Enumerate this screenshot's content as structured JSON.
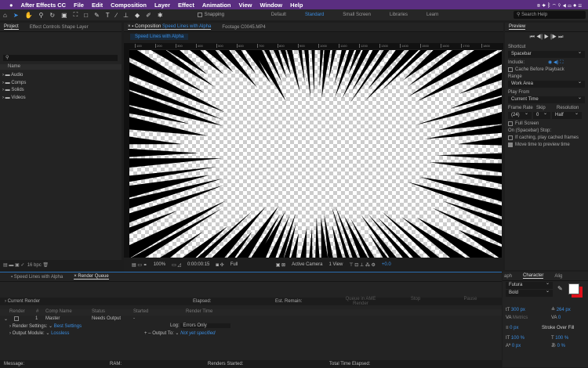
{
  "menubar": {
    "apple": "",
    "app": "After Effects CC",
    "items": [
      "File",
      "Edit",
      "Composition",
      "Layer",
      "Effect",
      "Animation",
      "View",
      "Window",
      "Help"
    ]
  },
  "toolbar": {
    "snapping": "Snapping",
    "workspaces": [
      "Default",
      "Standard",
      "Small Screen",
      "Libraries",
      "Learn"
    ],
    "active_workspace": "Standard",
    "search_placeholder": "Search Help"
  },
  "project": {
    "tabs": [
      "Project",
      "Effect Controls Shape Layer"
    ],
    "column": "Name",
    "folders": [
      "Audio",
      "Comps",
      "Solids",
      "Videos"
    ],
    "bpc": "16 bpc"
  },
  "comp": {
    "tab_prefix": "Composition",
    "tab_name": "Speed Lines with Alpha",
    "footage_tab": "Footage C0045.MP4",
    "breadcrumb": "Speed Lines with Alpha",
    "ruler": [
      "100",
      "200",
      "300",
      "400",
      "500",
      "600",
      "700",
      "800",
      "900",
      "1000",
      "1100",
      "1200",
      "1300",
      "1400",
      "1500",
      "1600",
      "1700",
      "1800"
    ],
    "zoom": "100%",
    "timecode": "0:00:00:15",
    "resolution": "Full",
    "camera": "Active Camera",
    "views": "1 View",
    "exposure": "+0.0"
  },
  "preview": {
    "title": "Preview",
    "shortcut_label": "Shortcut",
    "shortcut": "Spacebar",
    "include_label": "Include:",
    "cache_before": "Cache Before Playback",
    "range_label": "Range",
    "range": "Work Area",
    "play_from_label": "Play From",
    "play_from": "Current Time",
    "frame_rate_label": "Frame Rate",
    "skip_label": "Skip",
    "resolution_label": "Resolution",
    "frame_rate": "(24)",
    "skip": "0",
    "resolution": "Half",
    "full_screen": "Full Screen",
    "stop_label": "On (Spacebar) Stop:",
    "if_caching": "If caching, play cached frames",
    "move_time": "Move time to preview time",
    "move_time_checked": true
  },
  "render_queue": {
    "tabs": [
      "Speed Lines with Alpha",
      "Render Queue"
    ],
    "current_render": "Current Render",
    "elapsed": "Elapsed:",
    "est_remain": "Est. Remain:",
    "buttons": [
      "Queue in AME",
      "Stop",
      "Pause",
      "Render"
    ],
    "columns": [
      "Render",
      "#",
      "Comp Name",
      "Status",
      "Started",
      "Render Time"
    ],
    "item": {
      "num": "1",
      "comp": "Master",
      "status": "Needs Output",
      "started": "-"
    },
    "render_settings_label": "Render Settings:",
    "render_settings": "Best Settings",
    "log_label": "Log:",
    "log": "Errors Only",
    "output_module_label": "Output Module:",
    "output_module": "Lossless",
    "output_to_label": "Output To:",
    "output_to": "Not yet specified",
    "footer": {
      "message": "Message:",
      "ram": "RAM:",
      "renders_started": "Renders Started:",
      "total_time": "Total Time Elapsed:"
    }
  },
  "character": {
    "tabs": [
      "aph",
      "Character",
      "Alig"
    ],
    "font": "Futura",
    "style": "Bold",
    "size": "300 px",
    "leading": "264 px",
    "kerning": "Metrics",
    "tracking": "0",
    "stroke": "0 px",
    "stroke_type": "Stroke Over Fill",
    "vscale": "100 %",
    "hscale": "100 %",
    "baseline": "0 px",
    "tsume": "0 %",
    "fill_color": "#ffffff",
    "stroke_color": "#e0101a"
  }
}
